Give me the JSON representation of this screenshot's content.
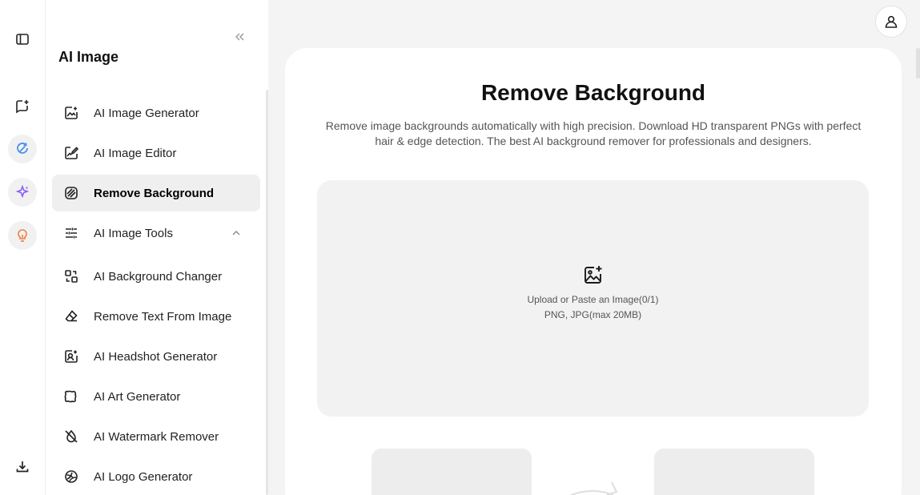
{
  "sidebar": {
    "title": "AI Image",
    "items": [
      {
        "label": "AI Image Generator",
        "icon": "image-sparkle-icon"
      },
      {
        "label": "AI Image Editor",
        "icon": "image-edit-icon"
      },
      {
        "label": "Remove Background",
        "icon": "remove-background-icon",
        "active": true
      },
      {
        "label": "AI Image Tools",
        "icon": "sliders-icon",
        "expanded": true
      },
      {
        "label": "AI Background Changer",
        "icon": "background-changer-icon"
      },
      {
        "label": "Remove Text From Image",
        "icon": "eraser-icon"
      },
      {
        "label": "AI Headshot Generator",
        "icon": "headshot-icon"
      },
      {
        "label": "AI Art Generator",
        "icon": "art-icon"
      },
      {
        "label": "AI Watermark Remover",
        "icon": "watermark-remover-icon"
      },
      {
        "label": "AI Logo Generator",
        "icon": "logo-icon"
      }
    ]
  },
  "rail": {
    "icons": [
      "sidebar-toggle-icon",
      "new-chat-icon",
      "refresh-icon",
      "sparkle-icon",
      "lightbulb-icon",
      "download-icon"
    ],
    "accent_blue": "#4a8ff0",
    "accent_purple": "#8b5cf6",
    "accent_orange": "#f07b3f"
  },
  "main": {
    "title": "Remove Background",
    "description": "Remove image backgrounds automatically with high precision. Download HD transparent PNGs with perfect hair & edge detection. The best AI background remover for professionals and designers.",
    "upload": {
      "label": "Upload or Paste an Image(0/1)",
      "formats": "PNG, JPG(max 20MB)"
    }
  }
}
